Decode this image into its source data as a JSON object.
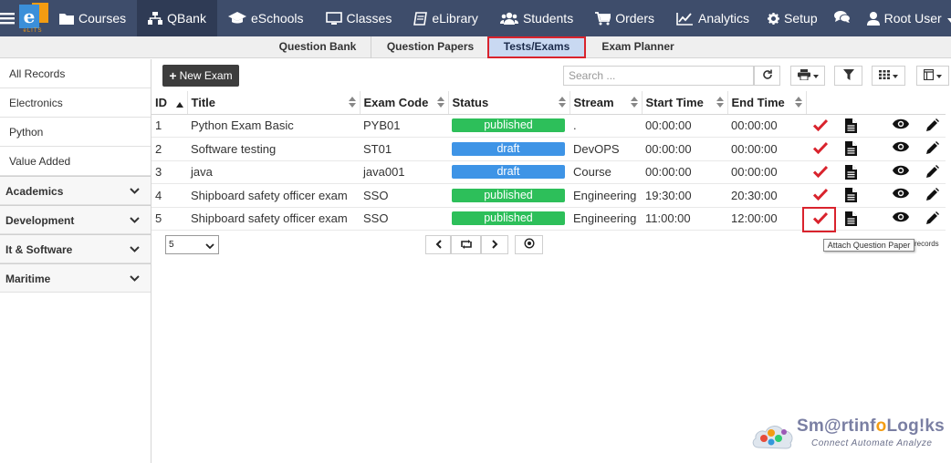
{
  "topnav": {
    "logo_letter": "e",
    "logo_sub": "eLITS",
    "items": [
      {
        "label": "Courses",
        "icon": "folder-icon"
      },
      {
        "label": "QBank",
        "icon": "sitemap-icon"
      },
      {
        "label": "eSchools",
        "icon": "graduation-cap-icon"
      },
      {
        "label": "Classes",
        "icon": "monitor-icon"
      },
      {
        "label": "eLibrary",
        "icon": "book-icon"
      },
      {
        "label": "Students",
        "icon": "users-icon"
      },
      {
        "label": "Orders",
        "icon": "cart-icon"
      },
      {
        "label": "Analytics",
        "icon": "line-chart-icon"
      }
    ],
    "setup_label": "Setup",
    "user_label": "Root User"
  },
  "subtabs": [
    "Question Bank",
    "Question Papers",
    "Tests/Exams",
    "Exam Planner"
  ],
  "sidebar": {
    "items": [
      "All Records",
      "Electronics",
      "Python",
      "Value Added"
    ],
    "groups": [
      "Academics",
      "Development",
      "It & Software",
      "Maritime"
    ]
  },
  "toolbar": {
    "new_exam_label": "New Exam",
    "search_placeholder": "Search ..."
  },
  "table": {
    "columns": [
      "ID",
      "Title",
      "Exam Code",
      "Status",
      "Stream",
      "Start Time",
      "End Time"
    ],
    "rows": [
      {
        "id": "1",
        "title": "Python Exam Basic",
        "code": "PYB01",
        "status": "published",
        "stream": ".",
        "start": "00:00:00",
        "end": "00:00:00"
      },
      {
        "id": "2",
        "title": "Software testing",
        "code": "ST01",
        "status": "draft",
        "stream": "DevOPS",
        "start": "00:00:00",
        "end": "00:00:00"
      },
      {
        "id": "3",
        "title": "java",
        "code": "java001",
        "status": "draft",
        "stream": "Course",
        "start": "00:00:00",
        "end": "00:00:00"
      },
      {
        "id": "4",
        "title": "Shipboard safety officer exam",
        "code": "SSO",
        "status": "published",
        "stream": "Engineering",
        "start": "19:30:00",
        "end": "20:30:00"
      },
      {
        "id": "5",
        "title": "Shipboard safety officer exam",
        "code": "SSO",
        "status": "published",
        "stream": "Engineering",
        "start": "11:00:00",
        "end": "12:00:00"
      }
    ]
  },
  "pager": {
    "page_size": "5",
    "tooltip": "Attach Question Paper",
    "records_fragment": "records"
  },
  "brand": {
    "name_part1": "Sm@rtinf",
    "name_o": "o",
    "name_part2": "Log!ks",
    "tagline": "Connect Automate Analyze"
  },
  "colors": {
    "nav_bg": "#3e4d6b",
    "published": "#2dbf5a",
    "draft": "#3e94e6",
    "check_red": "#d9232d"
  }
}
